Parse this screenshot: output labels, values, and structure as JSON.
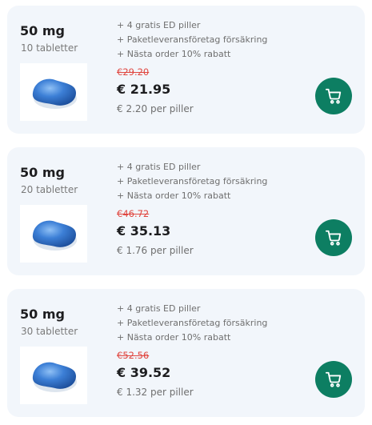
{
  "products": [
    {
      "dose": "50 mg",
      "count": "10 tabletter",
      "benefits": [
        "+ 4 gratis ED piller",
        "+ Paketleveransföretag försäkring",
        "+ Nästa order 10% rabatt"
      ],
      "old_price": "€29.20",
      "price": "€ 21.95",
      "unit_price": "€ 2.20 per piller",
      "image_icon": "blue-pill-image",
      "cart_icon": "cart-icon"
    },
    {
      "dose": "50 mg",
      "count": "20 tabletter",
      "benefits": [
        "+ 4 gratis ED piller",
        "+ Paketleveransföretag försäkring",
        "+ Nästa order 10% rabatt"
      ],
      "old_price": "€46.72",
      "price": "€ 35.13",
      "unit_price": "€ 1.76 per piller",
      "image_icon": "blue-pill-image",
      "cart_icon": "cart-icon"
    },
    {
      "dose": "50 mg",
      "count": "30 tabletter",
      "benefits": [
        "+ 4 gratis ED piller",
        "+ Paketleveransföretag försäkring",
        "+ Nästa order 10% rabatt"
      ],
      "old_price": "€52.56",
      "price": "€ 39.52",
      "unit_price": "€ 1.32 per piller",
      "image_icon": "blue-pill-image",
      "cart_icon": "cart-icon"
    }
  ],
  "colors": {
    "card_background": "#f2f6fb",
    "old_price": "#e0463f",
    "cart_button": "#0d7e62",
    "pill": "#3c7fd6"
  }
}
